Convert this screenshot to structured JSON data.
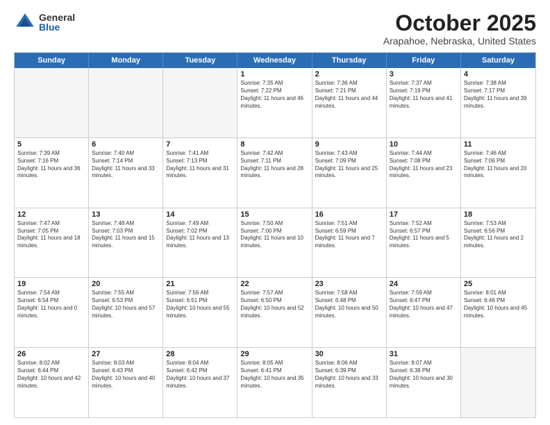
{
  "logo": {
    "general": "General",
    "blue": "Blue"
  },
  "title": "October 2025",
  "location": "Arapahoe, Nebraska, United States",
  "weekdays": [
    "Sunday",
    "Monday",
    "Tuesday",
    "Wednesday",
    "Thursday",
    "Friday",
    "Saturday"
  ],
  "rows": [
    [
      {
        "day": "",
        "info": "",
        "shaded": true
      },
      {
        "day": "",
        "info": "",
        "shaded": true
      },
      {
        "day": "",
        "info": "",
        "shaded": true
      },
      {
        "day": "1",
        "info": "Sunrise: 7:35 AM\nSunset: 7:22 PM\nDaylight: 11 hours and 46 minutes."
      },
      {
        "day": "2",
        "info": "Sunrise: 7:36 AM\nSunset: 7:21 PM\nDaylight: 11 hours and 44 minutes."
      },
      {
        "day": "3",
        "info": "Sunrise: 7:37 AM\nSunset: 7:19 PM\nDaylight: 11 hours and 41 minutes."
      },
      {
        "day": "4",
        "info": "Sunrise: 7:38 AM\nSunset: 7:17 PM\nDaylight: 11 hours and 39 minutes."
      }
    ],
    [
      {
        "day": "5",
        "info": "Sunrise: 7:39 AM\nSunset: 7:16 PM\nDaylight: 11 hours and 36 minutes."
      },
      {
        "day": "6",
        "info": "Sunrise: 7:40 AM\nSunset: 7:14 PM\nDaylight: 11 hours and 33 minutes."
      },
      {
        "day": "7",
        "info": "Sunrise: 7:41 AM\nSunset: 7:13 PM\nDaylight: 11 hours and 31 minutes."
      },
      {
        "day": "8",
        "info": "Sunrise: 7:42 AM\nSunset: 7:11 PM\nDaylight: 11 hours and 28 minutes."
      },
      {
        "day": "9",
        "info": "Sunrise: 7:43 AM\nSunset: 7:09 PM\nDaylight: 11 hours and 25 minutes."
      },
      {
        "day": "10",
        "info": "Sunrise: 7:44 AM\nSunset: 7:08 PM\nDaylight: 11 hours and 23 minutes."
      },
      {
        "day": "11",
        "info": "Sunrise: 7:46 AM\nSunset: 7:06 PM\nDaylight: 11 hours and 20 minutes."
      }
    ],
    [
      {
        "day": "12",
        "info": "Sunrise: 7:47 AM\nSunset: 7:05 PM\nDaylight: 11 hours and 18 minutes."
      },
      {
        "day": "13",
        "info": "Sunrise: 7:48 AM\nSunset: 7:03 PM\nDaylight: 11 hours and 15 minutes."
      },
      {
        "day": "14",
        "info": "Sunrise: 7:49 AM\nSunset: 7:02 PM\nDaylight: 11 hours and 13 minutes."
      },
      {
        "day": "15",
        "info": "Sunrise: 7:50 AM\nSunset: 7:00 PM\nDaylight: 11 hours and 10 minutes."
      },
      {
        "day": "16",
        "info": "Sunrise: 7:51 AM\nSunset: 6:59 PM\nDaylight: 11 hours and 7 minutes."
      },
      {
        "day": "17",
        "info": "Sunrise: 7:52 AM\nSunset: 6:57 PM\nDaylight: 11 hours and 5 minutes."
      },
      {
        "day": "18",
        "info": "Sunrise: 7:53 AM\nSunset: 6:56 PM\nDaylight: 11 hours and 2 minutes."
      }
    ],
    [
      {
        "day": "19",
        "info": "Sunrise: 7:54 AM\nSunset: 6:54 PM\nDaylight: 11 hours and 0 minutes."
      },
      {
        "day": "20",
        "info": "Sunrise: 7:55 AM\nSunset: 6:53 PM\nDaylight: 10 hours and 57 minutes."
      },
      {
        "day": "21",
        "info": "Sunrise: 7:56 AM\nSunset: 6:51 PM\nDaylight: 10 hours and 55 minutes."
      },
      {
        "day": "22",
        "info": "Sunrise: 7:57 AM\nSunset: 6:50 PM\nDaylight: 10 hours and 52 minutes."
      },
      {
        "day": "23",
        "info": "Sunrise: 7:58 AM\nSunset: 6:48 PM\nDaylight: 10 hours and 50 minutes."
      },
      {
        "day": "24",
        "info": "Sunrise: 7:59 AM\nSunset: 6:47 PM\nDaylight: 10 hours and 47 minutes."
      },
      {
        "day": "25",
        "info": "Sunrise: 8:01 AM\nSunset: 6:46 PM\nDaylight: 10 hours and 45 minutes."
      }
    ],
    [
      {
        "day": "26",
        "info": "Sunrise: 8:02 AM\nSunset: 6:44 PM\nDaylight: 10 hours and 42 minutes."
      },
      {
        "day": "27",
        "info": "Sunrise: 8:03 AM\nSunset: 6:43 PM\nDaylight: 10 hours and 40 minutes."
      },
      {
        "day": "28",
        "info": "Sunrise: 8:04 AM\nSunset: 6:42 PM\nDaylight: 10 hours and 37 minutes."
      },
      {
        "day": "29",
        "info": "Sunrise: 8:05 AM\nSunset: 6:41 PM\nDaylight: 10 hours and 35 minutes."
      },
      {
        "day": "30",
        "info": "Sunrise: 8:06 AM\nSunset: 6:39 PM\nDaylight: 10 hours and 33 minutes."
      },
      {
        "day": "31",
        "info": "Sunrise: 8:07 AM\nSunset: 6:38 PM\nDaylight: 10 hours and 30 minutes."
      },
      {
        "day": "",
        "info": "",
        "shaded": true
      }
    ]
  ]
}
